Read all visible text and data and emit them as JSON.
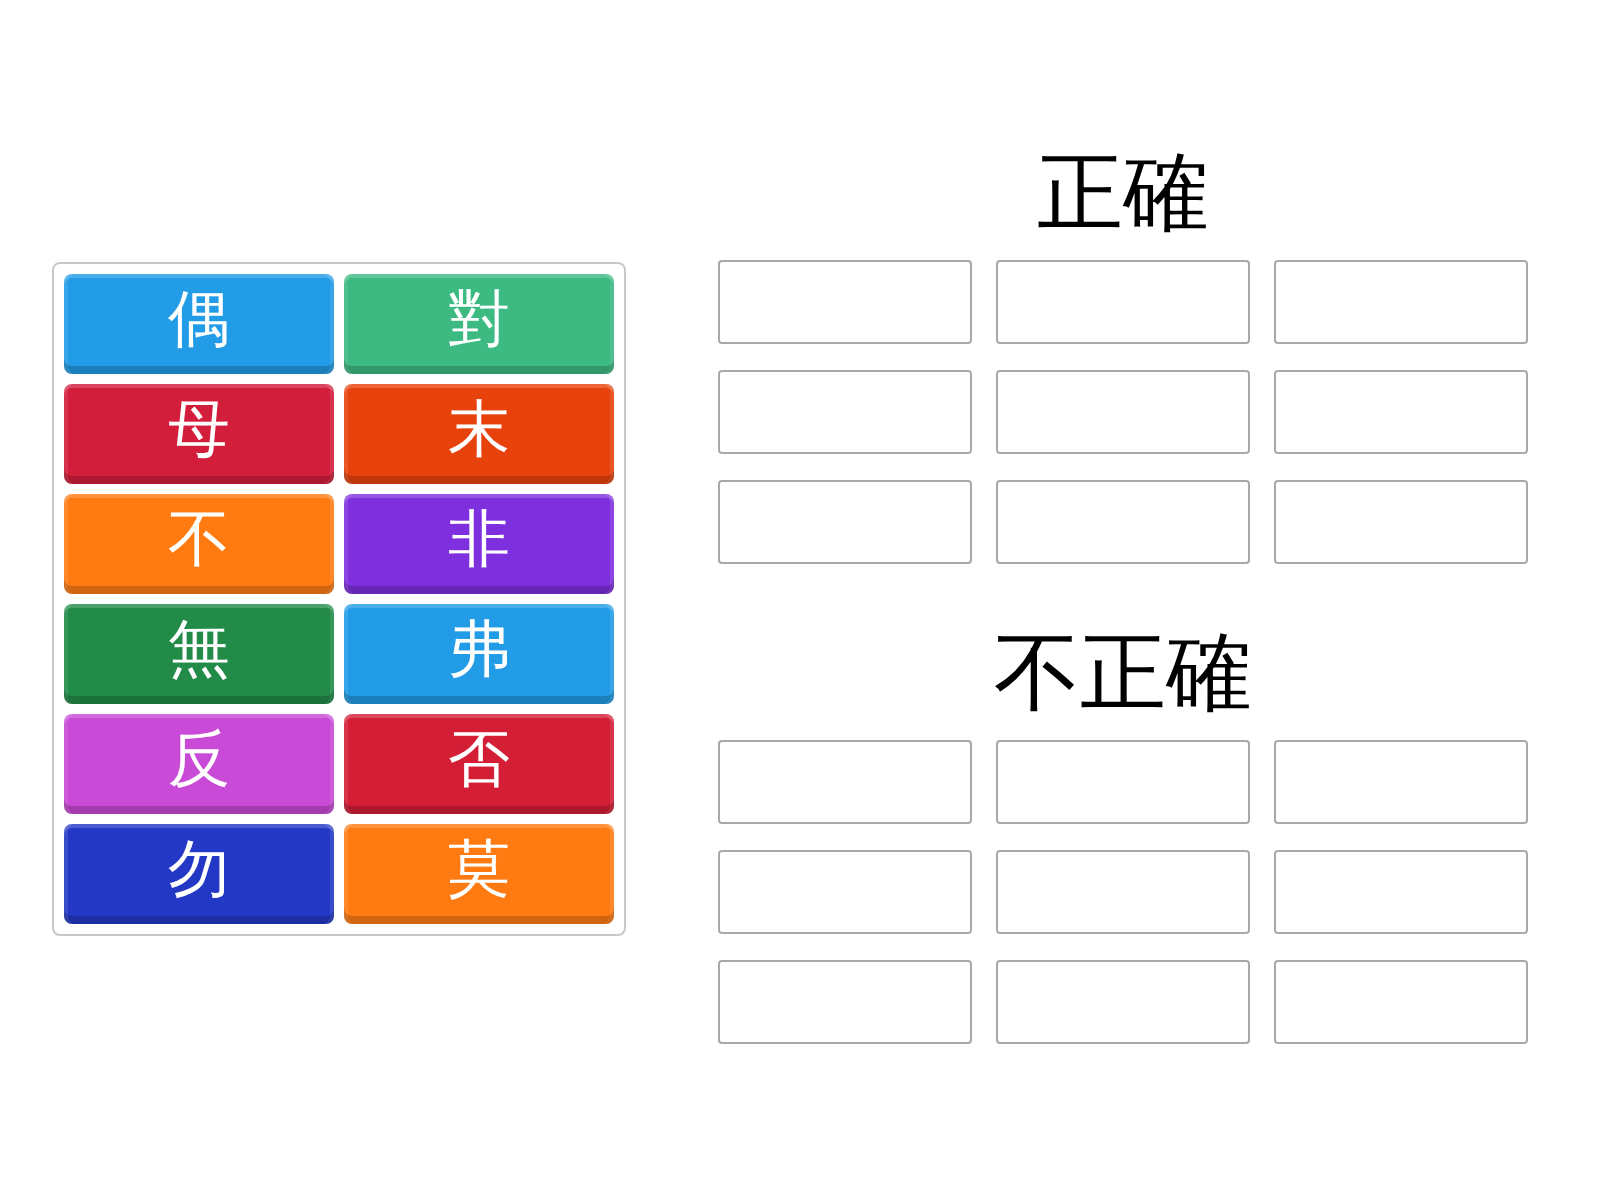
{
  "word_tiles": [
    {
      "text": "偶",
      "color": "#229ce6"
    },
    {
      "text": "對",
      "color": "#3dba82"
    },
    {
      "text": "母",
      "color": "#d21e3a"
    },
    {
      "text": "末",
      "color": "#e8420c"
    },
    {
      "text": "不",
      "color": "#ff7b12"
    },
    {
      "text": "非",
      "color": "#7e30df"
    },
    {
      "text": "無",
      "color": "#218b47"
    },
    {
      "text": "弗",
      "color": "#229ce6"
    },
    {
      "text": "反",
      "color": "#c94ad6"
    },
    {
      "text": "否",
      "color": "#d41e36"
    },
    {
      "text": "勿",
      "color": "#2339c6"
    },
    {
      "text": "莫",
      "color": "#ff7b12"
    }
  ],
  "groups": [
    {
      "title": "正確",
      "slots": [
        {
          "kind": "empty"
        },
        {
          "kind": "empty"
        },
        {
          "kind": "empty"
        },
        {
          "kind": "empty"
        },
        {
          "kind": "empty"
        },
        {
          "kind": "empty"
        },
        {
          "kind": "empty"
        },
        {
          "kind": "empty"
        },
        {
          "kind": "empty"
        }
      ]
    },
    {
      "title": "不正確",
      "slots": [
        {
          "kind": "empty"
        },
        {
          "kind": "empty"
        },
        {
          "kind": "empty"
        },
        {
          "kind": "empty"
        },
        {
          "kind": "empty"
        },
        {
          "kind": "empty"
        },
        {
          "kind": "empty"
        },
        {
          "kind": "empty"
        },
        {
          "kind": "empty"
        }
      ]
    }
  ]
}
